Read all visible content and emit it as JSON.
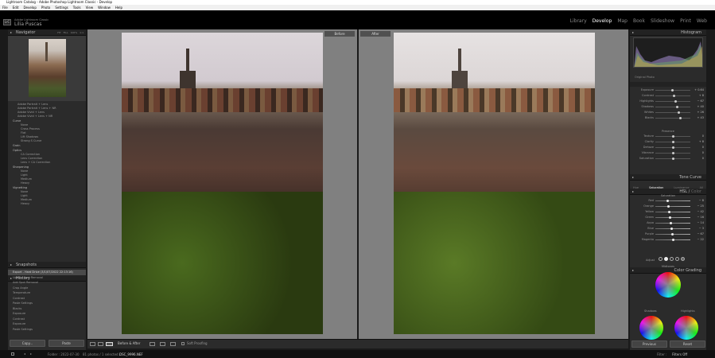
{
  "window_title": "Lightroom Catalog - Adobe Photoshop Lightroom Classic - Develop",
  "menu": [
    "File",
    "Edit",
    "Develop",
    "Photo",
    "Settings",
    "Tools",
    "View",
    "Window",
    "Help"
  ],
  "identity": {
    "logo": "LrC",
    "app": "Adobe Lightroom Classic",
    "user": "Lilia Puscas"
  },
  "modules": [
    "Library",
    "Develop",
    "Map",
    "Book",
    "Slideshow",
    "Print",
    "Web"
  ],
  "left": {
    "navigator": "Navigator",
    "nav_zoom": [
      "FIT",
      "FILL",
      "100%",
      "1:1"
    ],
    "presets": [
      "Adobe Portrait + Lens",
      "Adobe Portrait + Lens + NR",
      "Adobe Vivid + Lens",
      "Adobe Vivid + Lens + NR"
    ],
    "groups": [
      {
        "name": "Curve",
        "items": [
          "None",
          "Cross Process",
          "Flat",
          "Lift Shadows",
          "Strong S Curve"
        ]
      },
      {
        "name": "Grain",
        "items": []
      },
      {
        "name": "Optics",
        "items": [
          "CA Correction",
          "Lens Correction",
          "Lens + CA Correction"
        ]
      },
      {
        "name": "Sharpening",
        "items": [
          "None",
          "Light",
          "Medium",
          "Heavy"
        ]
      },
      {
        "name": "Vignetting",
        "items": [
          "None",
          "Light",
          "Medium",
          "Heavy"
        ]
      }
    ],
    "snapshots": "Snapshots",
    "history": "History",
    "history_items": [
      "Export - Hard Drive (3/1/07/2022 22:13:16)",
      "Update Spot Removal",
      "Add Spot Removal",
      "Crop Angle",
      "Temperature",
      "Contrast",
      "Paste Settings",
      "Blacks",
      "Exposure",
      "Contrast",
      "Exposure",
      "Paste Settings"
    ],
    "copy": "Copy...",
    "paste": "Paste"
  },
  "center": {
    "before": "Before",
    "after": "After",
    "view_mode": "Before & After",
    "soft_proofing": "Soft Proofing"
  },
  "right": {
    "histogram": "Histogram",
    "original_photo": "Original Photo",
    "basic": [
      {
        "l": "Exposure",
        "v": "+ 0.64"
      },
      {
        "l": "Contrast",
        "v": "+ 8"
      },
      {
        "l": "Highlights",
        "v": "− 67"
      },
      {
        "l": "Shadows",
        "v": "+ 40"
      },
      {
        "l": "Whites",
        "v": "+ 26"
      },
      {
        "l": "Blacks",
        "v": "+ 43"
      }
    ],
    "presence": "Presence",
    "presence_items": [
      {
        "l": "Texture",
        "v": "0"
      },
      {
        "l": "Clarity",
        "v": "+ 8"
      },
      {
        "l": "Dehaze",
        "v": "0"
      },
      {
        "l": "Vibrance",
        "v": "0"
      },
      {
        "l": "Saturation",
        "v": "0"
      }
    ],
    "tone_curve": "Tone Curve",
    "hsl": "HSL",
    "color": "Color",
    "hsl_tabs": [
      "Hue",
      "Saturation",
      "Luminance",
      "All"
    ],
    "sat_label": "Saturation",
    "hsl_items": [
      {
        "l": "Red",
        "v": "− 8"
      },
      {
        "l": "Orange",
        "v": "− 25"
      },
      {
        "l": "Yellow",
        "v": "− 42"
      },
      {
        "l": "Green",
        "v": "− 16"
      },
      {
        "l": "Aqua",
        "v": "− 14"
      },
      {
        "l": "Blue",
        "v": "− 3"
      },
      {
        "l": "Purple",
        "v": "− 67"
      },
      {
        "l": "Magenta",
        "v": "− 22"
      }
    ],
    "color_grading": "Color Grading",
    "adjust": "Adjust",
    "midtones": "Midtones",
    "shadows": "Shadows",
    "highlights": "Highlights",
    "previous": "Previous",
    "reset": "Reset"
  },
  "filmstrip": {
    "folder": "Folder : 2022-07-30",
    "count": "81 photos / 1 selected /",
    "file": "DSC_9996.NEF",
    "filter": "Filter :",
    "filter_val": "Filters Off"
  }
}
